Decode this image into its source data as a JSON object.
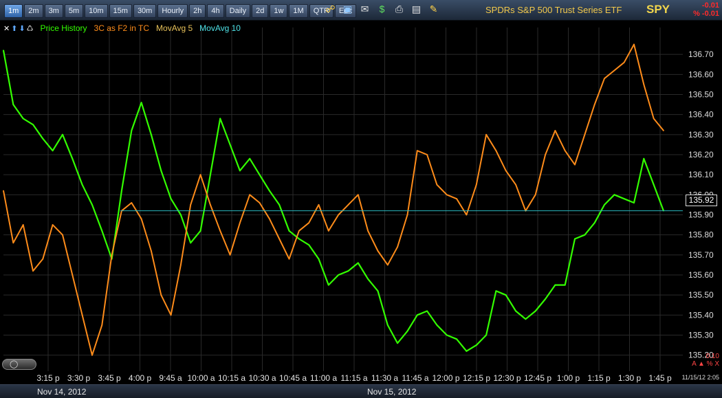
{
  "toolbar": {
    "timeframes": [
      "1m",
      "2m",
      "3m",
      "5m",
      "10m",
      "15m",
      "30m",
      "Hourly",
      "2h",
      "4h",
      "Daily",
      "2d",
      "1w",
      "1M",
      "QTR",
      "Edit"
    ],
    "active_timeframe": "1m",
    "icons": [
      "lock-icon",
      "save-icon",
      "email-icon",
      "dollar-icon",
      "print-icon",
      "window-icon",
      "pencil-icon"
    ],
    "security_name": "SPDRs S&P 500 Trust Series ETF",
    "ticker": "SPY",
    "change_abs": "-0.01",
    "change_pct": "% -0.01"
  },
  "legend": {
    "price_history": "Price History",
    "indicator": "3C as F2 in TC",
    "movavg5": "MovAvg 5",
    "movavg10": "MovAvg 10"
  },
  "colors": {
    "price": "#33ff00",
    "indicator": "#ff8c1a",
    "movavg5": "#e8c25a",
    "movavg10": "#4fe3e8",
    "last_price_line": "#2ab8c0",
    "grid": "#2a2a2a"
  },
  "bottom": {
    "date1": "Nov 14, 2012",
    "date2": "Nov 15, 2012",
    "indicator_value": "0.10",
    "indicator_ctrl": "A ▲ % X",
    "timestamp": "11/15/12 2:05"
  },
  "last_price": "135.92",
  "chart_data": {
    "type": "line",
    "title": "SPDRs S&P 500 Trust Series ETF",
    "xlabel": "",
    "ylabel": "",
    "ylim": [
      135.12,
      136.8
    ],
    "x_tick_labels": [
      "3:15 p",
      "3:30 p",
      "3:45 p",
      "4:00 p",
      "9:45 a",
      "10:00 a",
      "10:15 a",
      "10:30 a",
      "10:45 a",
      "11:00 a",
      "11:15 a",
      "11:30 a",
      "11:45 a",
      "12:00 p",
      "12:15 p",
      "12:30 p",
      "12:45 p",
      "1:00 p",
      "1:15 p",
      "1:30 p",
      "1:45 p"
    ],
    "y_tick_labels": [
      "136.70",
      "136.60",
      "136.50",
      "136.40",
      "136.30",
      "136.20",
      "136.10",
      "136.00",
      "135.90",
      "135.80",
      "135.70",
      "135.60",
      "135.50",
      "135.40",
      "135.30",
      "135.20"
    ],
    "grid": true,
    "series": [
      {
        "name": "Price History",
        "x": [
          "3:05 p",
          "3:10 p",
          "3:15 p",
          "3:20 p",
          "3:25 p",
          "3:30 p",
          "3:35 p",
          "3:40 p",
          "3:45 p",
          "3:50 p",
          "3:55 p",
          "4:00 p",
          "9:30 a",
          "9:35 a",
          "9:40 a",
          "9:45 a",
          "9:50 a",
          "9:55 a",
          "10:00 a",
          "10:05 a",
          "10:10 a",
          "10:15 a",
          "10:20 a",
          "10:25 a",
          "10:30 a",
          "10:35 a",
          "10:40 a",
          "10:45 a",
          "10:50 a",
          "10:55 a",
          "11:00 a",
          "11:05 a",
          "11:10 a",
          "11:15 a",
          "11:20 a",
          "11:25 a",
          "11:30 a",
          "11:35 a",
          "11:40 a",
          "11:45 a",
          "11:50 a",
          "11:55 a",
          "12:00 p",
          "12:05 p",
          "12:10 p",
          "12:15 p",
          "12:20 p",
          "12:25 p",
          "12:30 p",
          "12:35 p",
          "12:40 p",
          "12:45 p",
          "12:50 p",
          "12:55 p",
          "1:00 p",
          "1:05 p",
          "1:10 p",
          "1:15 p",
          "1:20 p",
          "1:25 p",
          "1:30 p",
          "1:35 p",
          "1:40 p",
          "1:45 p",
          "1:50 p",
          "1:55 p",
          "2:00 p",
          "2:05 p"
        ],
        "values": [
          136.72,
          136.45,
          136.38,
          136.35,
          136.28,
          136.22,
          136.3,
          136.18,
          136.05,
          135.95,
          135.82,
          135.68,
          136.02,
          136.32,
          136.46,
          136.3,
          136.12,
          135.98,
          135.9,
          135.76,
          135.82,
          136.1,
          136.38,
          136.25,
          136.12,
          136.18,
          136.1,
          136.02,
          135.95,
          135.82,
          135.78,
          135.75,
          135.68,
          135.55,
          135.6,
          135.62,
          135.66,
          135.58,
          135.52,
          135.35,
          135.26,
          135.32,
          135.4,
          135.42,
          135.35,
          135.3,
          135.28,
          135.22,
          135.25,
          135.3,
          135.52,
          135.5,
          135.42,
          135.38,
          135.42,
          135.48,
          135.55,
          135.55,
          135.78,
          135.8,
          135.86,
          135.95,
          136.0,
          135.98,
          135.96,
          136.18,
          136.05,
          135.92
        ]
      },
      {
        "name": "3C as F2 in TC",
        "x": [
          "3:05 p",
          "3:10 p",
          "3:15 p",
          "3:20 p",
          "3:25 p",
          "3:30 p",
          "3:35 p",
          "3:40 p",
          "3:45 p",
          "3:50 p",
          "3:55 p",
          "4:00 p",
          "9:30 a",
          "9:35 a",
          "9:40 a",
          "9:45 a",
          "9:50 a",
          "9:55 a",
          "10:00 a",
          "10:05 a",
          "10:10 a",
          "10:15 a",
          "10:20 a",
          "10:25 a",
          "10:30 a",
          "10:35 a",
          "10:40 a",
          "10:45 a",
          "10:50 a",
          "10:55 a",
          "11:00 a",
          "11:05 a",
          "11:10 a",
          "11:15 a",
          "11:20 a",
          "11:25 a",
          "11:30 a",
          "11:35 a",
          "11:40 a",
          "11:45 a",
          "11:50 a",
          "11:55 a",
          "12:00 p",
          "12:05 p",
          "12:10 p",
          "12:15 p",
          "12:20 p",
          "12:25 p",
          "12:30 p",
          "12:35 p",
          "12:40 p",
          "12:45 p",
          "12:50 p",
          "12:55 p",
          "1:00 p",
          "1:05 p",
          "1:10 p",
          "1:15 p",
          "1:20 p",
          "1:25 p",
          "1:30 p",
          "1:35 p",
          "1:40 p",
          "1:45 p",
          "1:50 p",
          "1:55 p",
          "2:00 p",
          "2:05 p"
        ],
        "values": [
          136.02,
          135.76,
          135.85,
          135.62,
          135.68,
          135.85,
          135.8,
          135.6,
          135.4,
          135.2,
          135.35,
          135.7,
          135.92,
          135.96,
          135.88,
          135.72,
          135.5,
          135.4,
          135.65,
          135.95,
          136.1,
          135.95,
          135.82,
          135.7,
          135.86,
          136.0,
          135.96,
          135.88,
          135.78,
          135.68,
          135.82,
          135.86,
          135.95,
          135.82,
          135.9,
          135.95,
          136.0,
          135.82,
          135.72,
          135.65,
          135.74,
          135.9,
          136.22,
          136.2,
          136.05,
          136.0,
          135.98,
          135.9,
          136.05,
          136.3,
          136.22,
          136.12,
          136.05,
          135.92,
          136.0,
          136.2,
          136.32,
          136.22,
          136.15,
          136.3,
          136.45,
          136.58,
          136.62,
          136.66,
          136.75,
          136.55,
          136.38,
          136.32
        ]
      }
    ]
  }
}
